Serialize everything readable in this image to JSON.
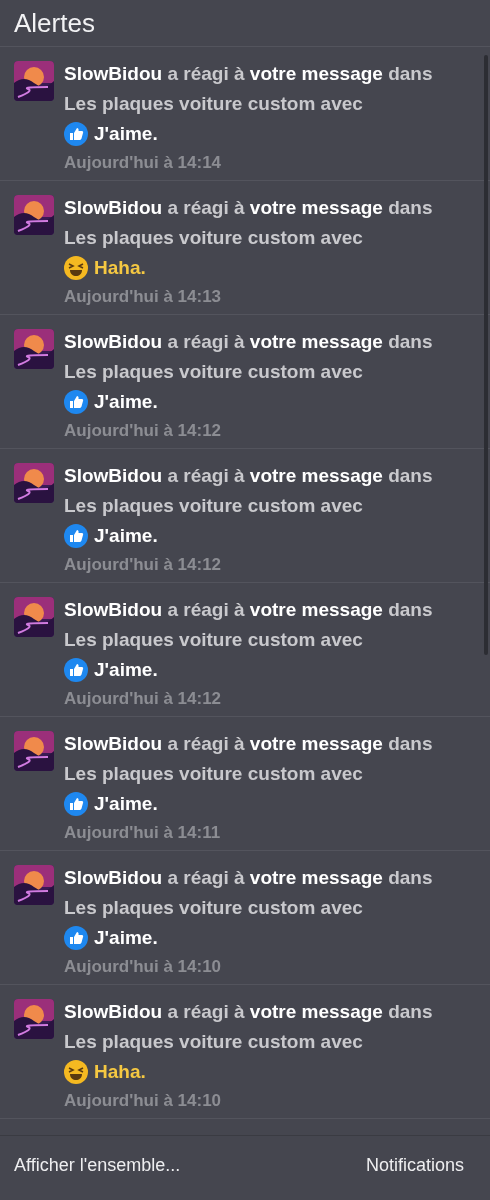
{
  "header": {
    "title": "Alertes"
  },
  "alerts": [
    {
      "text": "**SlowBidou** a réagi à **votre message** dans Les plaques voiture custom avec",
      "reaction": {
        "kind": "like",
        "label": "J'aime."
      },
      "time": "Aujourd'hui à 14:14"
    },
    {
      "text": "**SlowBidou** a réagi à **votre message** dans Les plaques voiture custom avec",
      "reaction": {
        "kind": "haha",
        "label": "Haha."
      },
      "time": "Aujourd'hui à 14:13"
    },
    {
      "text": "**SlowBidou** a réagi à **votre message** dans Les plaques voiture custom avec",
      "reaction": {
        "kind": "like",
        "label": "J'aime."
      },
      "time": "Aujourd'hui à 14:12"
    },
    {
      "text": "**SlowBidou** a réagi à **votre message** dans Les plaques voiture custom avec",
      "reaction": {
        "kind": "like",
        "label": "J'aime."
      },
      "time": "Aujourd'hui à 14:12"
    },
    {
      "text": "**SlowBidou** a réagi à **votre message** dans Les plaques voiture custom avec",
      "reaction": {
        "kind": "like",
        "label": "J'aime."
      },
      "time": "Aujourd'hui à 14:12"
    },
    {
      "text": "**SlowBidou** a réagi à **votre message** dans Les plaques voiture custom avec",
      "reaction": {
        "kind": "like",
        "label": "J'aime."
      },
      "time": "Aujourd'hui à 14:11"
    },
    {
      "text": "**SlowBidou** a réagi à **votre message** dans Les plaques voiture custom avec",
      "reaction": {
        "kind": "like",
        "label": "J'aime."
      },
      "time": "Aujourd'hui à 14:10"
    },
    {
      "text": "**SlowBidou** a réagi à **votre message** dans Les plaques voiture custom avec",
      "reaction": {
        "kind": "haha",
        "label": "Haha."
      },
      "time": "Aujourd'hui à 14:10"
    }
  ],
  "footer": {
    "left_link": "Afficher l'ensemble...",
    "right_link": "Notifications"
  }
}
